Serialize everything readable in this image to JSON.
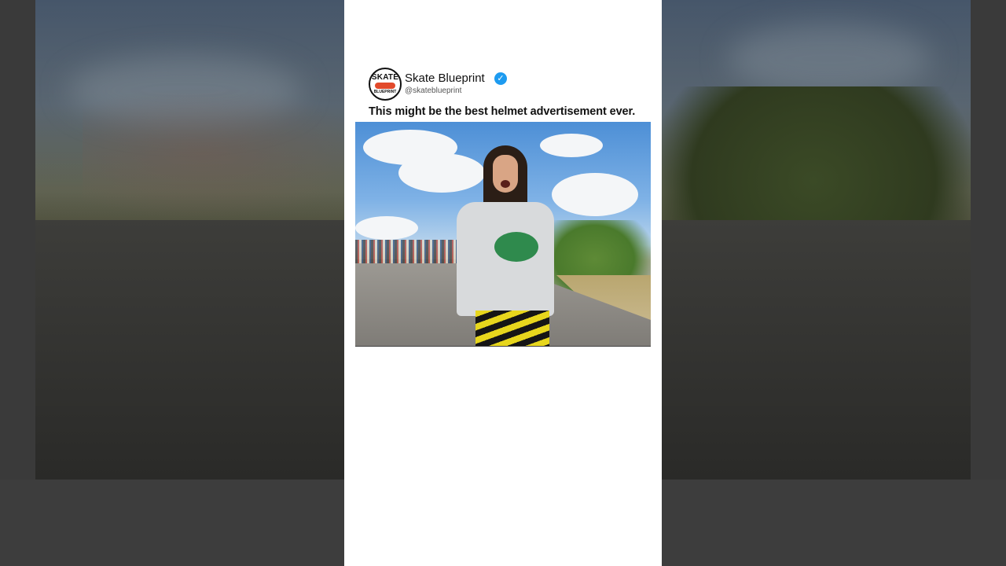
{
  "post": {
    "avatar_text_top": "SKATE",
    "avatar_text_bottom": "BLUEPRINT",
    "display_name": "Skate Blueprint",
    "verified_icon": "verified-checkmark-icon",
    "verified_glyph": "✓",
    "handle": "@skateblueprint",
    "text": "This might be the best helmet advertisement ever."
  },
  "colors": {
    "card_background": "#ffffff",
    "verified_blue": "#1d9bf0",
    "backdrop": "#3a3a3a"
  }
}
